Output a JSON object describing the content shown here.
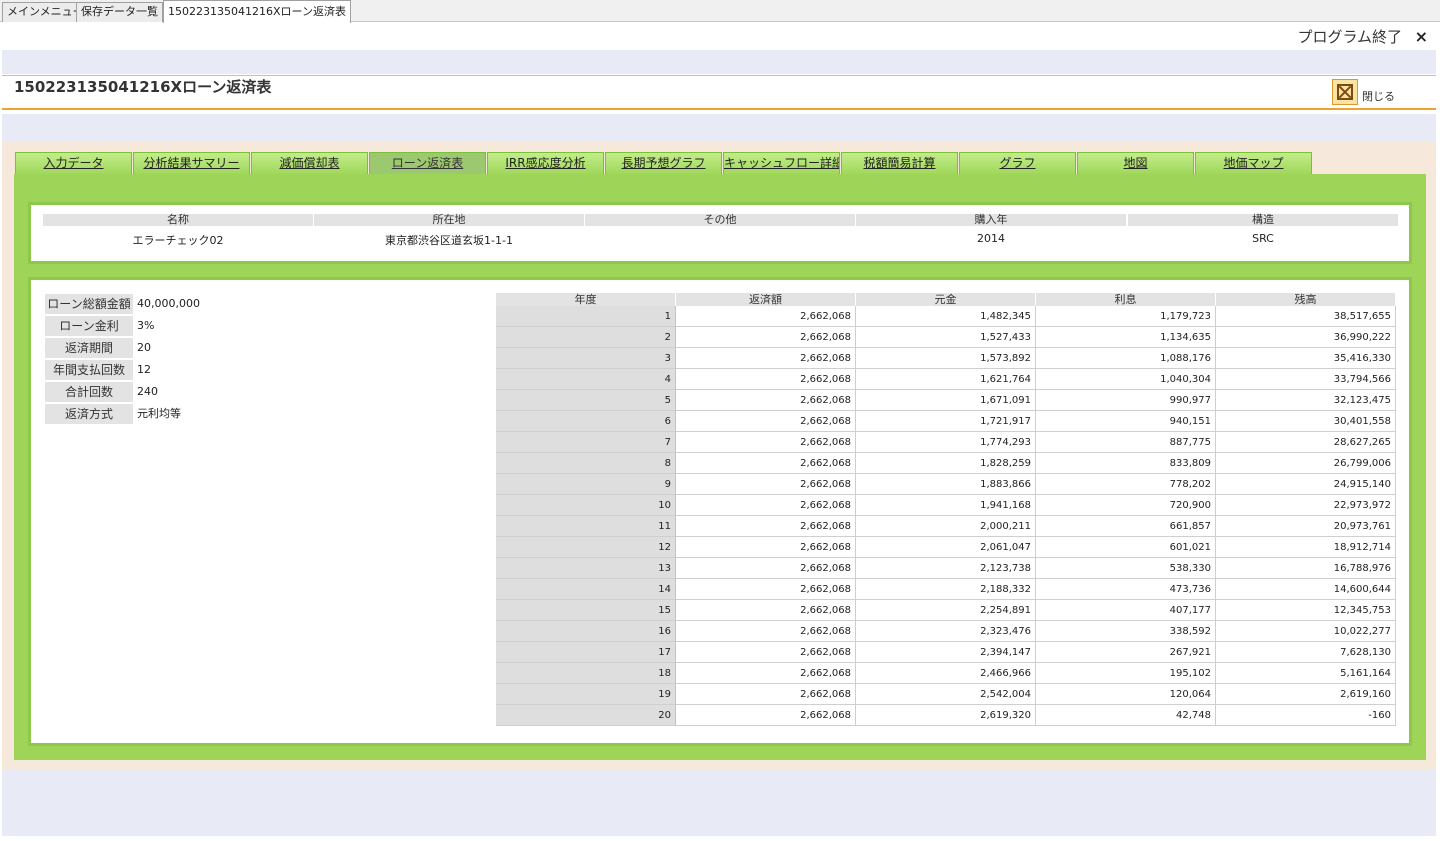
{
  "doc_tabs": [
    "メインメニュー",
    "保存データ一覧",
    "150223135041216Xローン返済表"
  ],
  "header": {
    "exit_label": "プログラム終了",
    "exit_icon": "×"
  },
  "page_title": "150223135041216Xローン返済表",
  "close_label": "閉じる",
  "tabs": [
    "入力データ",
    "分析結果サマリー",
    "減価償却表",
    "ローン返済表",
    "IRR感応度分析",
    "長期予想グラフ",
    "キャッシュフロー詳細",
    "税額簡易計算",
    "グラフ",
    "地図",
    "地価マップ"
  ],
  "property": {
    "headers": [
      "名称",
      "所在地",
      "その他",
      "購入年",
      "構造"
    ],
    "values": [
      "エラーチェック02",
      "東京都渋谷区道玄坂1-1-1",
      "",
      "2014",
      "SRC"
    ]
  },
  "loan_info": [
    {
      "label": "ローン総額金額",
      "value": "40,000,000"
    },
    {
      "label": "ローン金利",
      "value": "3%"
    },
    {
      "label": "返済期間",
      "value": "20"
    },
    {
      "label": "年間支払回数",
      "value": "12"
    },
    {
      "label": "合計回数",
      "value": "240"
    },
    {
      "label": "返済方式",
      "value": "元利均等"
    }
  ],
  "schedule": {
    "headers": [
      "年度",
      "返済額",
      "元金",
      "利息",
      "残高"
    ],
    "rows": [
      [
        "1",
        "2,662,068",
        "1,482,345",
        "1,179,723",
        "38,517,655"
      ],
      [
        "2",
        "2,662,068",
        "1,527,433",
        "1,134,635",
        "36,990,222"
      ],
      [
        "3",
        "2,662,068",
        "1,573,892",
        "1,088,176",
        "35,416,330"
      ],
      [
        "4",
        "2,662,068",
        "1,621,764",
        "1,040,304",
        "33,794,566"
      ],
      [
        "5",
        "2,662,068",
        "1,671,091",
        "990,977",
        "32,123,475"
      ],
      [
        "6",
        "2,662,068",
        "1,721,917",
        "940,151",
        "30,401,558"
      ],
      [
        "7",
        "2,662,068",
        "1,774,293",
        "887,775",
        "28,627,265"
      ],
      [
        "8",
        "2,662,068",
        "1,828,259",
        "833,809",
        "26,799,006"
      ],
      [
        "9",
        "2,662,068",
        "1,883,866",
        "778,202",
        "24,915,140"
      ],
      [
        "10",
        "2,662,068",
        "1,941,168",
        "720,900",
        "22,973,972"
      ],
      [
        "11",
        "2,662,068",
        "2,000,211",
        "661,857",
        "20,973,761"
      ],
      [
        "12",
        "2,662,068",
        "2,061,047",
        "601,021",
        "18,912,714"
      ],
      [
        "13",
        "2,662,068",
        "2,123,738",
        "538,330",
        "16,788,976"
      ],
      [
        "14",
        "2,662,068",
        "2,188,332",
        "473,736",
        "14,600,644"
      ],
      [
        "15",
        "2,662,068",
        "2,254,891",
        "407,177",
        "12,345,753"
      ],
      [
        "16",
        "2,662,068",
        "2,323,476",
        "338,592",
        "10,022,277"
      ],
      [
        "17",
        "2,662,068",
        "2,394,147",
        "267,921",
        "7,628,130"
      ],
      [
        "18",
        "2,662,068",
        "2,466,966",
        "195,102",
        "5,161,164"
      ],
      [
        "19",
        "2,662,068",
        "2,542,004",
        "120,064",
        "2,619,160"
      ],
      [
        "20",
        "2,662,068",
        "2,619,320",
        "42,748",
        "-160"
      ]
    ]
  },
  "colors": {
    "green": "#9ed457",
    "orange": "#f0a030",
    "band": "#e8eaf6"
  }
}
